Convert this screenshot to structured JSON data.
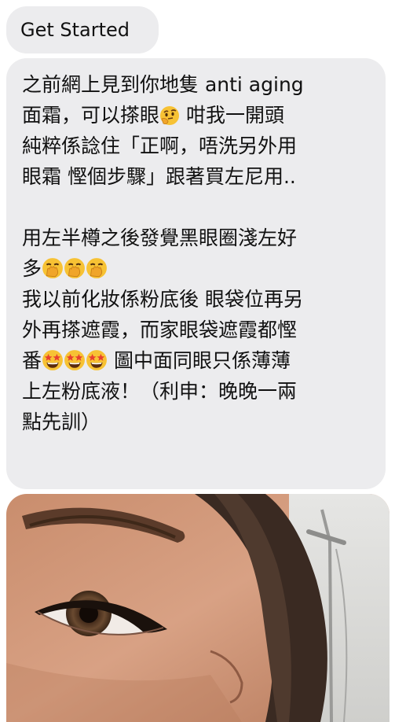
{
  "chat": {
    "first_message": "Get Started",
    "message": {
      "line1": "之前網上見到你地隻 anti aging",
      "line2a": "面霜，可以搽眼",
      "line2b": "咁我一開頭",
      "line3": "純粹係諗住「正啊，唔洗另外用",
      "line4": "眼霜 慳個步驟」跟著買左尼用..",
      "line5": "用左半樽之後發覺黑眼圈淺左好",
      "line6a": "多",
      "line7": "我以前化妝係粉底後 眼袋位再另",
      "line8": "外再搽遮霞，而家眼袋遮霞都慳",
      "line9a": "番",
      "line9b": "圖中面同眼只係薄薄",
      "line10": "上左粉底液！（利申：晚晚一兩",
      "line11": "點先訓）"
    },
    "emojis": {
      "thinking": "thinking-face",
      "hand_over_mouth": "hand-over-mouth-face",
      "star_struck": "star-struck-face"
    },
    "photo": {
      "subject": "eye-closeup"
    }
  }
}
